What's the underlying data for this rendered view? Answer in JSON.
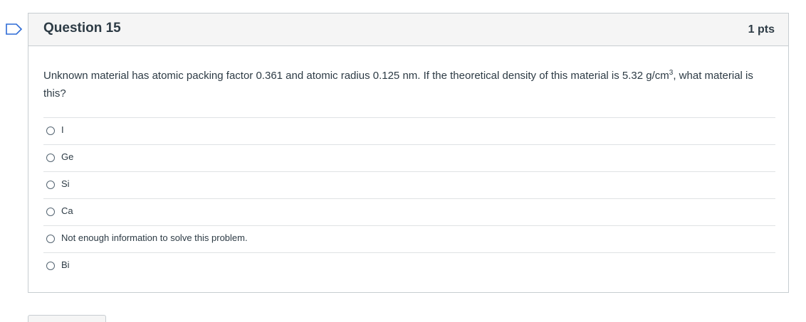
{
  "question": {
    "title": "Question 15",
    "points": "1 pts",
    "text_main": "Unknown material has atomic packing factor 0.361 and atomic radius 0.125 nm. If the theoretical density of this material is 5.32 g/cm",
    "text_sup": "3",
    "text_tail": ", what material is this?",
    "flag_icon": "flag-outline-icon",
    "answers": [
      {
        "label": "I"
      },
      {
        "label": "Ge"
      },
      {
        "label": "Si"
      },
      {
        "label": "Ca"
      },
      {
        "label": "Not enough information to solve this problem."
      },
      {
        "label": "Bi"
      }
    ]
  }
}
